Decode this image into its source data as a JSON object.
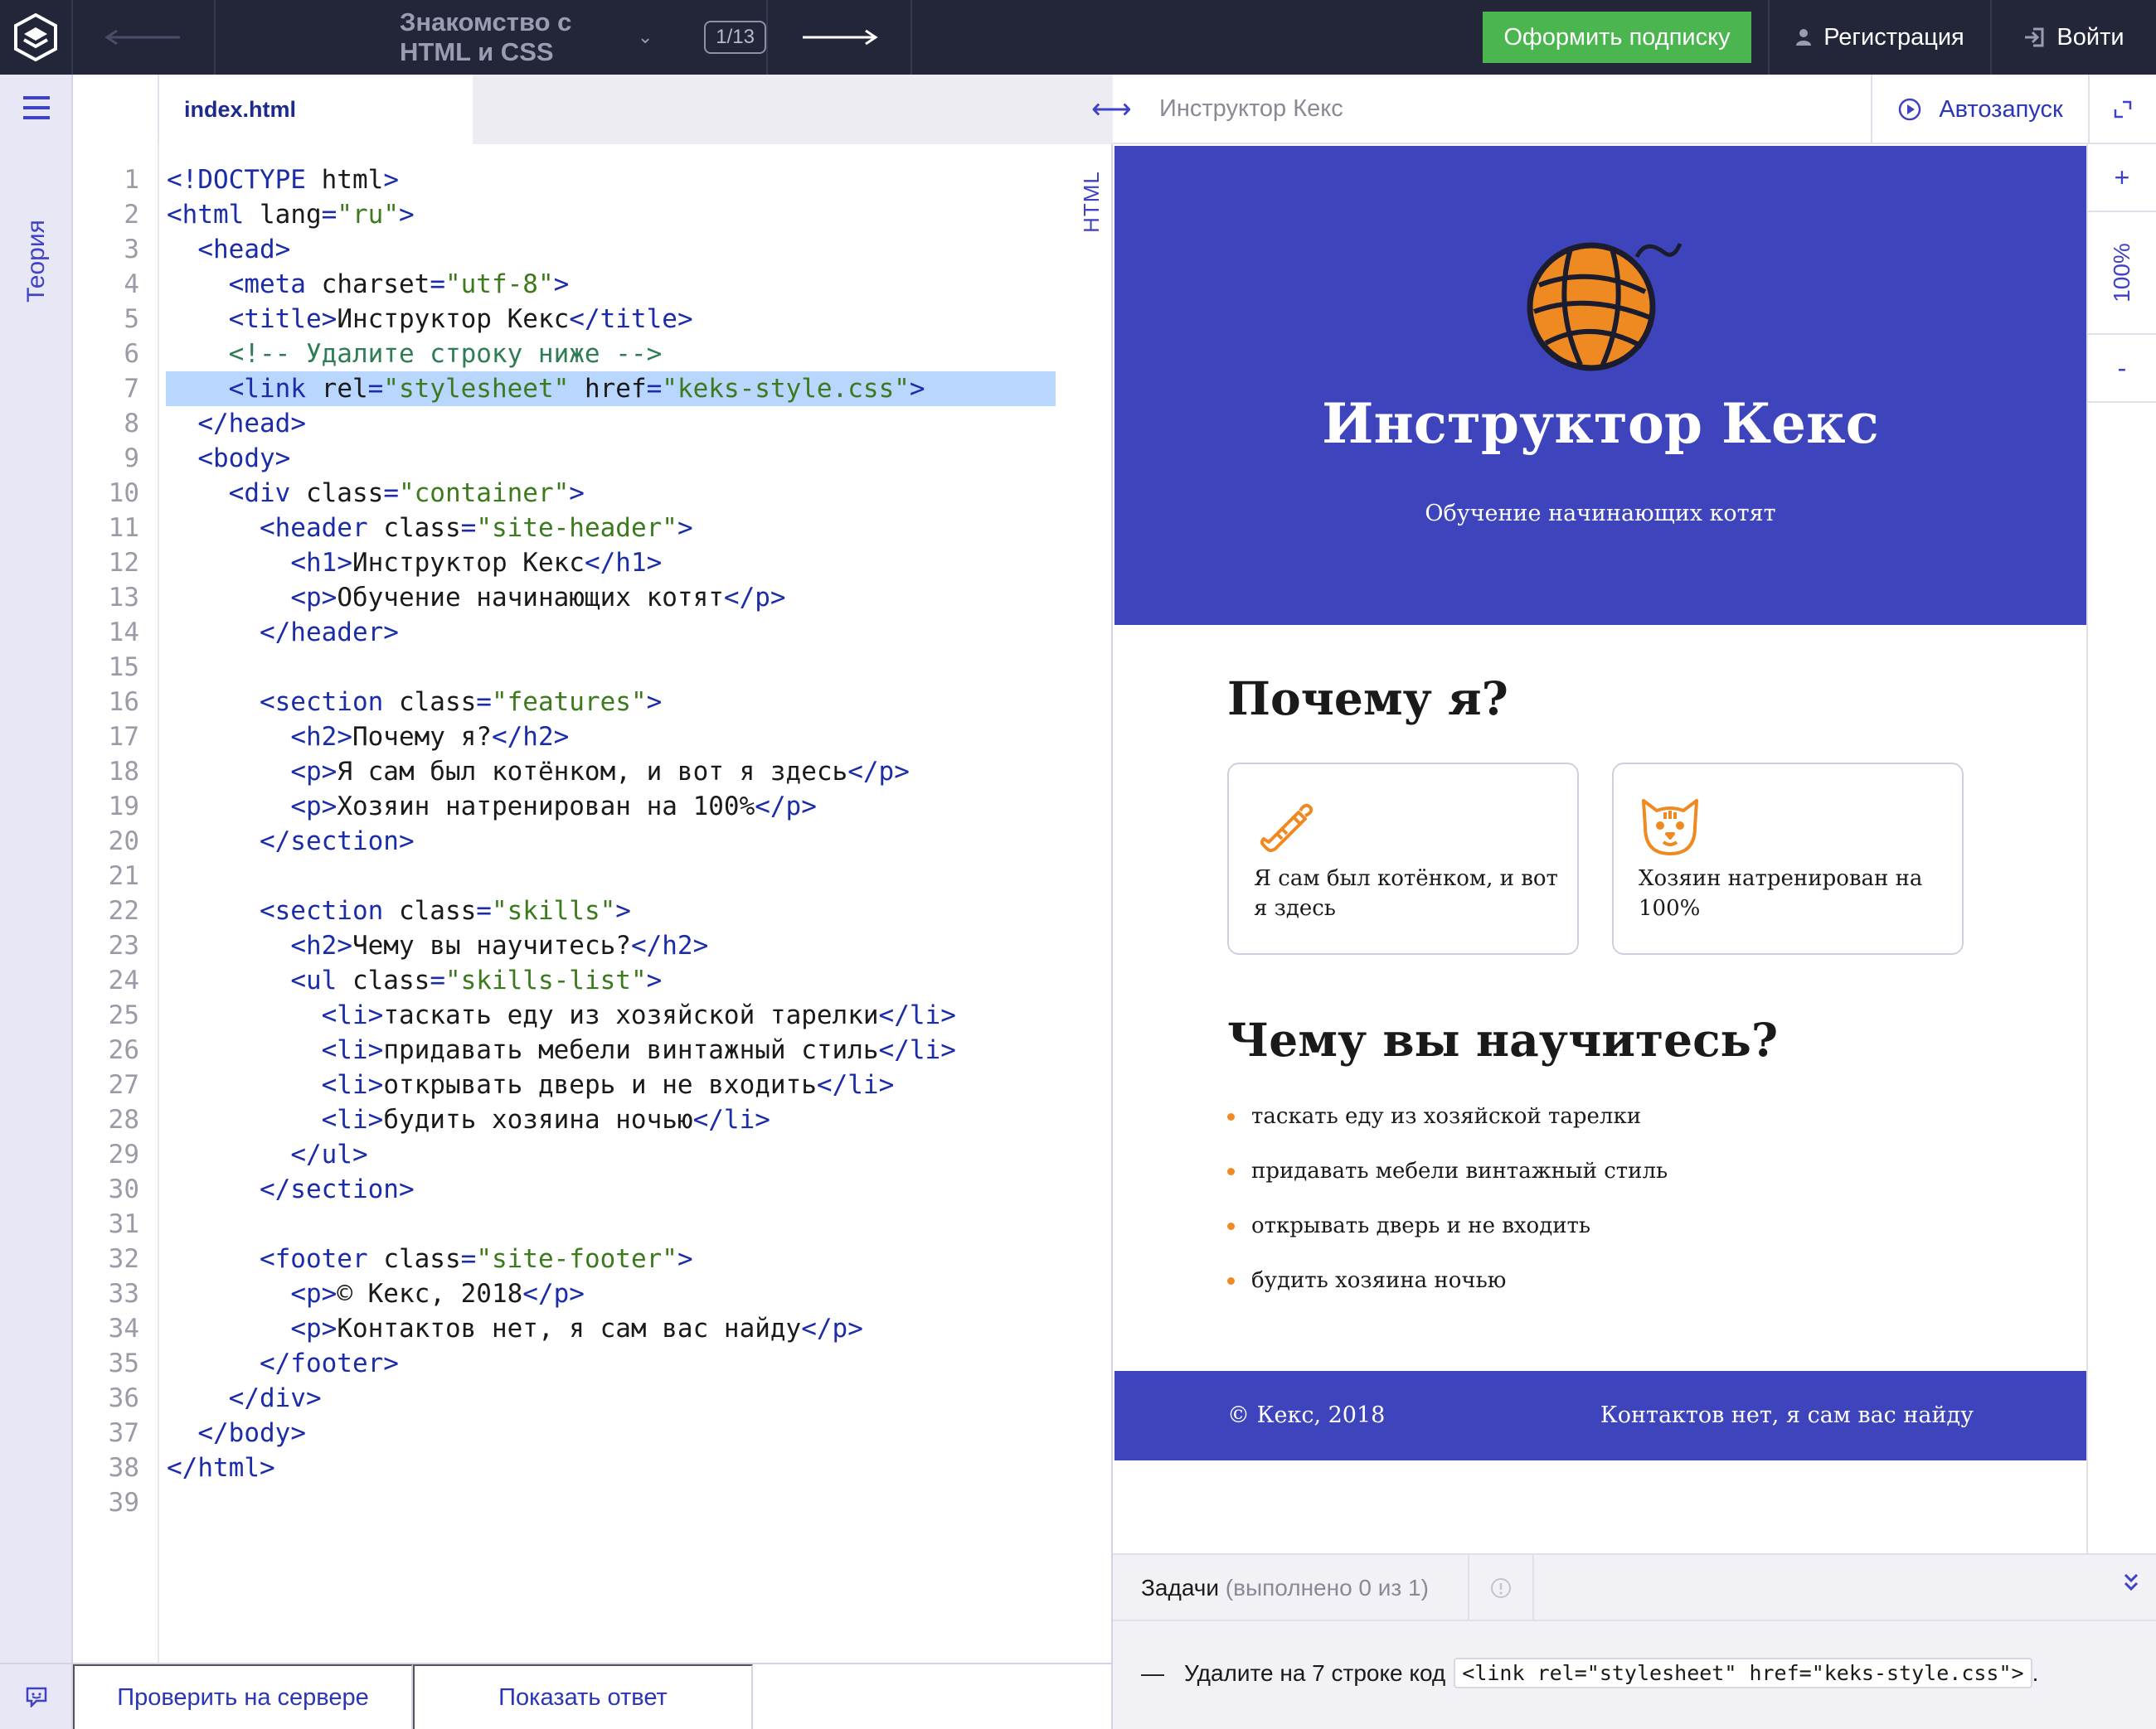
{
  "topbar": {
    "course_title": "Знакомство с HTML и CSS",
    "pager": "1/13",
    "subscribe_label": "Оформить подписку",
    "register_label": "Регистрация",
    "login_label": "Войти"
  },
  "left_rail": {
    "theory_label": "Теория"
  },
  "editor": {
    "tab_label": "index.html",
    "mode_label": "HTML",
    "check_label": "Проверить на сервере",
    "answer_label": "Показать ответ",
    "highlighted_line": 7,
    "line_numbers": [
      "1",
      "2",
      "3",
      "4",
      "5",
      "6",
      "7",
      "8",
      "9",
      "10",
      "11",
      "12",
      "13",
      "14",
      "15",
      "16",
      "17",
      "18",
      "19",
      "20",
      "21",
      "22",
      "23",
      "24",
      "25",
      "26",
      "27",
      "28",
      "29",
      "30",
      "31",
      "32",
      "33",
      "34",
      "35",
      "36",
      "37",
      "38",
      "39"
    ],
    "lines": [
      "<!DOCTYPE html>",
      "<html lang=\"ru\">",
      "  <head>",
      "    <meta charset=\"utf-8\">",
      "    <title>Инструктор Кекс</title>",
      "    <!-- Удалите строку ниже -->",
      "    <link rel=\"stylesheet\" href=\"keks-style.css\">",
      "  </head>",
      "  <body>",
      "    <div class=\"container\">",
      "      <header class=\"site-header\">",
      "        <h1>Инструктор Кекс</h1>",
      "        <p>Обучение начинающих котят</p>",
      "      </header>",
      "",
      "      <section class=\"features\">",
      "        <h2>Почему я?</h2>",
      "        <p>Я сам был котёнком, и вот я здесь</p>",
      "        <p>Хозяин натренирован на 100%</p>",
      "      </section>",
      "",
      "      <section class=\"skills\">",
      "        <h2>Чему вы научитесь?</h2>",
      "        <ul class=\"skills-list\">",
      "          <li>таскать еду из хозяйской тарелки</li>",
      "          <li>придавать мебели винтажный стиль</li>",
      "          <li>открывать дверь и не входить</li>",
      "          <li>будить хозяина ночью</li>",
      "        </ul>",
      "      </section>",
      "",
      "      <footer class=\"site-footer\">",
      "        <p>© Кекс, 2018</p>",
      "        <p>Контактов нет, я сам вас найду</p>",
      "      </footer>",
      "    </div>",
      "  </body>",
      "</html>",
      ""
    ]
  },
  "preview_header": {
    "title": "Инструктор Кекс",
    "autorun_label": "Автозапуск",
    "zoom_plus": "+",
    "zoom_level": "100%",
    "zoom_minus": "-"
  },
  "preview": {
    "h1": "Инструктор Кекс",
    "subtitle": "Обучение начинающих котят",
    "features_title": "Почему я?",
    "feature_1": "Я сам был котёнком, и вот я здесь",
    "feature_2": "Хозяин натренирован на 100%",
    "skills_title": "Чему вы научитесь?",
    "skills": [
      "таскать еду из хозяйской тарелки",
      "придавать мебели винтажный стиль",
      "открывать дверь и не входить",
      "будить хозяина ночью"
    ],
    "footer_left": "© Кекс, 2018",
    "footer_right": "Контактов нет, я сам вас найду",
    "accent_color": "#3e45bc",
    "icon_color": "#ef8a22"
  },
  "tasks": {
    "title": "Задачи",
    "status": "(выполнено 0 из 1)",
    "item_text": "Удалите на 7 строке код",
    "item_code": "<link rel=\"stylesheet\" href=\"keks-style.css\">",
    "item_tail": "."
  },
  "icons": {
    "logo": "htmlacademy-logo-icon",
    "back": "arrow-left-icon",
    "next": "arrow-right-icon",
    "user": "user-icon",
    "login": "login-icon",
    "menu": "hamburger-menu-icon",
    "feedback": "feedback-icon",
    "resize": "resize-horizontal-icon",
    "autorun": "play-circle-icon",
    "expand": "expand-icon",
    "info": "info-icon",
    "collapse": "chevron-double-down-icon"
  }
}
